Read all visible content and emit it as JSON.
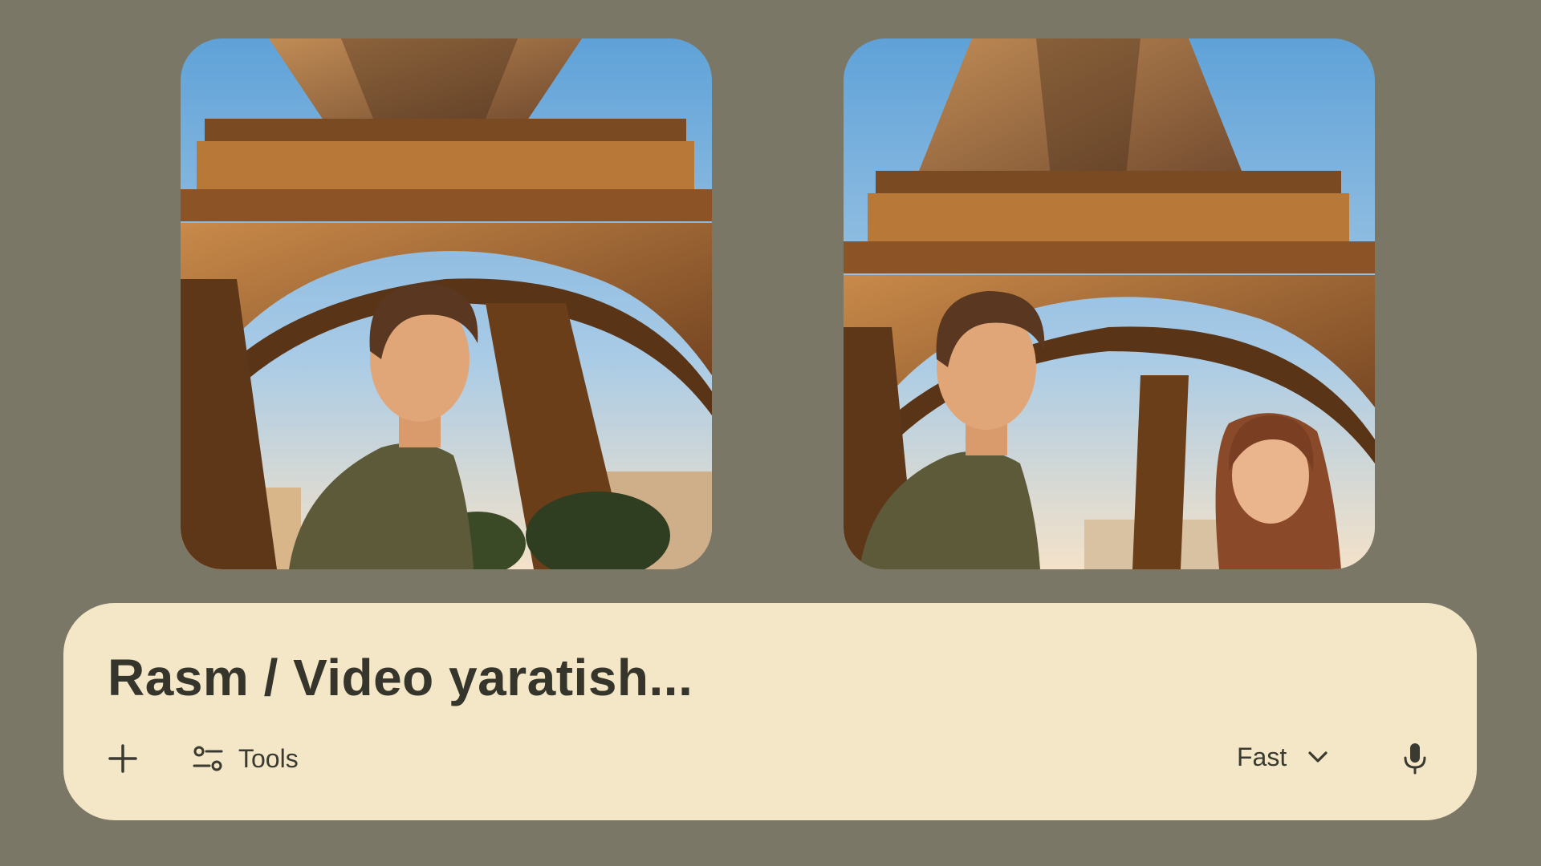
{
  "images": [
    {
      "name": "eiffel-photo-young-man",
      "description_icon": "photo-icon"
    },
    {
      "name": "eiffel-photo-young-man-and-girl",
      "description_icon": "photo-icon"
    }
  ],
  "prompt": {
    "placeholder": "Rasm / Video yaratish...",
    "tools_label": "Tools",
    "mode_label": "Fast",
    "icons": {
      "add": "plus-icon",
      "tools": "sliders-icon",
      "mode": "chevron-down-icon",
      "voice": "microphone-icon"
    }
  },
  "colors": {
    "background": "#7b7766",
    "prompt_box": "#f3e7c7",
    "text": "#36352b"
  }
}
